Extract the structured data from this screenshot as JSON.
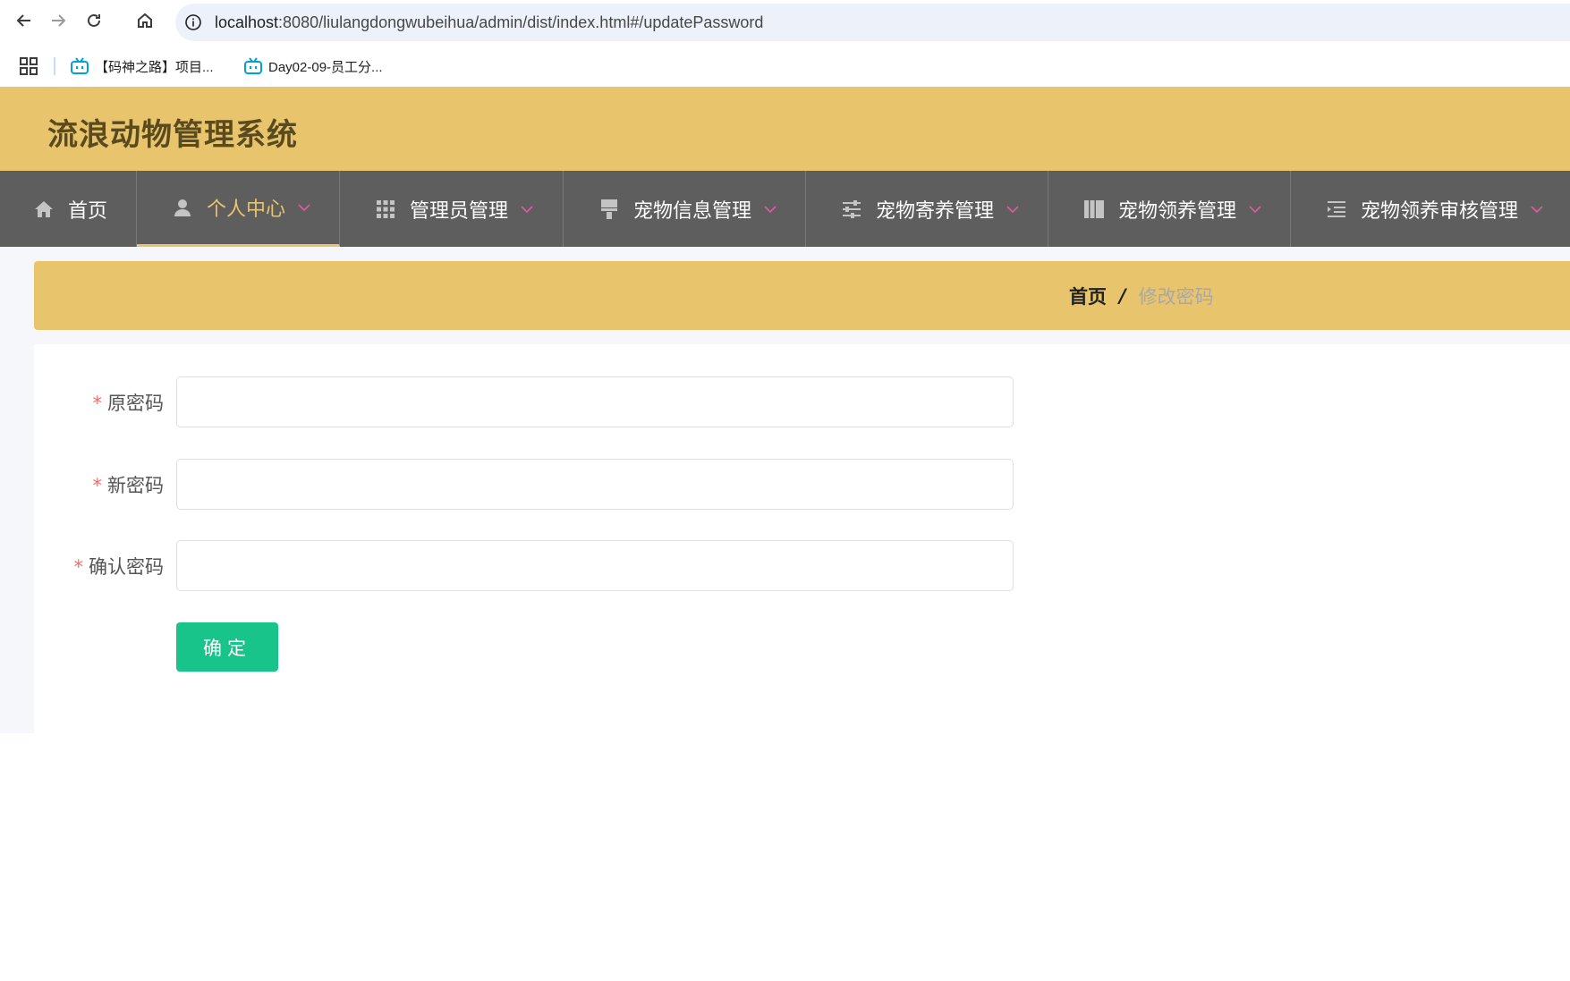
{
  "browser": {
    "url_host": "localhost",
    "url_path": ":8080/liulangdongwubeihua/admin/dist/index.html#/updatePassword",
    "bookmarks": [
      {
        "label": "【码神之路】项目..."
      },
      {
        "label": "Day02-09-员工分..."
      }
    ]
  },
  "header": {
    "title": "流浪动物管理系统"
  },
  "menu": {
    "items": [
      {
        "label": "首页",
        "icon": "home-icon"
      },
      {
        "label": "个人中心",
        "icon": "user-icon"
      },
      {
        "label": "管理员管理",
        "icon": "grid-icon"
      },
      {
        "label": "宠物信息管理",
        "icon": "brush-icon"
      },
      {
        "label": "宠物寄养管理",
        "icon": "sliders-icon"
      },
      {
        "label": "宠物领养管理",
        "icon": "books-icon"
      },
      {
        "label": "宠物领养审核管理",
        "icon": "list-icon"
      }
    ],
    "active_color": "#e8c46c"
  },
  "breadcrumb": {
    "home": "首页",
    "separator": "/",
    "current": "修改密码"
  },
  "form": {
    "fields": [
      {
        "label": "原密码",
        "value": ""
      },
      {
        "label": "新密码",
        "value": ""
      },
      {
        "label": "确认密码",
        "value": ""
      }
    ],
    "required_mark": "*",
    "submit_label": "确定",
    "submit_color": "#19c48a"
  }
}
